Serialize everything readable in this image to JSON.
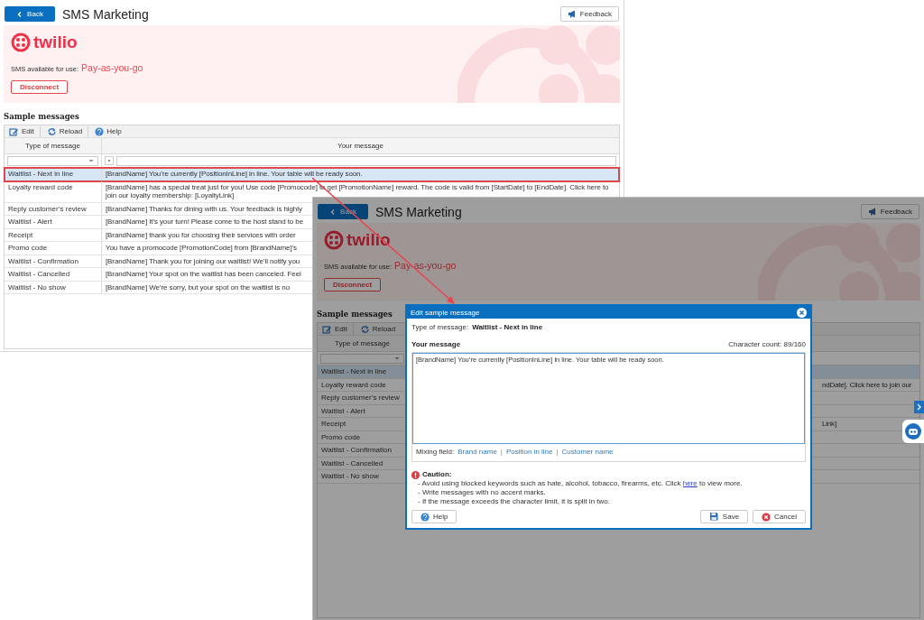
{
  "front_screen": {
    "back_button": "Back",
    "title": "SMS Marketing",
    "feedback_button": "Feedback",
    "banner": {
      "logo": "twilio",
      "sms_label": "SMS available for use:",
      "plan": "Pay-as-you-go",
      "disconnect_button": "Disconnect"
    },
    "section_title": "Sample messages",
    "toolbar": [
      {
        "label": "Edit",
        "kind": "edit"
      },
      {
        "label": "Reload",
        "kind": "reload"
      },
      {
        "label": "Help",
        "kind": "help"
      }
    ],
    "columns": [
      "Type of message",
      "Your message"
    ],
    "rows": [
      {
        "type": "Waitlist - Next in line",
        "message": "[BrandName] You’re currently [PositionInLine] in line. Your table will be ready soon.",
        "selected": true,
        "callout": true
      },
      {
        "type": "Loyalty reward code",
        "message": "[BrandName] has a special treat just for you! Use code [Promocode] to get [PromotionName] reward. The code is valid from [StartDate] to [EndDate]. Click here to join our loyalty membership: [LoyaltyLink]",
        "selected": false,
        "callout": false
      },
      {
        "type": "Reply customer’s review",
        "message": "[BrandName] Thanks for dining with us. Your feedback is highly",
        "selected": false,
        "callout": false
      },
      {
        "type": "Waitlist - Alert",
        "message": "[BrandName] It’s your turn! Please come to the host stand to be",
        "selected": false,
        "callout": false
      },
      {
        "type": "Receipt",
        "message": "[BrandName] thank you for choosing their services with order",
        "selected": false,
        "callout": false
      },
      {
        "type": "Promo code",
        "message": "You have a promocode [PromotionCode] from [BrandName]’s",
        "selected": false,
        "callout": false
      },
      {
        "type": "Waitlist - Confirmation",
        "message": "[BrandName] Thank you for joining our waitlist! We’ll notify you",
        "selected": false,
        "callout": false
      },
      {
        "type": "Waitlist - Cancelled",
        "message": "[BrandName] Your spot on the waitlist has been canceled. Feel",
        "selected": false,
        "callout": false
      },
      {
        "type": "Waitlist - No show",
        "message": "[BrandName] We’re sorry, but your spot on the waitlist is no",
        "selected": false,
        "callout": false
      }
    ]
  },
  "back_screen": {
    "back_button": "Back",
    "title": "SMS Marketing",
    "feedback_button": "Feedback",
    "banner": {
      "logo": "twilio",
      "sms_label": "SMS available for use:",
      "plan": "Pay-as-you-go",
      "disconnect_button": "Disconnect"
    },
    "section_title": "Sample messages",
    "toolbar": [
      {
        "label": "Edit",
        "kind": "edit"
      },
      {
        "label": "Reload",
        "kind": "reload"
      }
    ],
    "columns": [
      "Type of message"
    ],
    "rows": [
      {
        "type": "Waitlist - Next in line",
        "selected": true,
        "callout": false
      },
      {
        "type": "Loyalty reward code",
        "message": "ndDate]. Click here to join our",
        "selected": false,
        "callout": false
      },
      {
        "type": "Reply customer’s review",
        "selected": false,
        "callout": false
      },
      {
        "type": "Waitlist - Alert",
        "selected": false,
        "callout": false
      },
      {
        "type": "Receipt",
        "message": "Link]",
        "selected": false,
        "callout": false
      },
      {
        "type": "Promo code",
        "selected": false,
        "callout": false
      },
      {
        "type": "Waitlist - Confirmation",
        "selected": false,
        "callout": false
      },
      {
        "type": "Waitlist - Cancelled",
        "selected": false,
        "callout": false
      },
      {
        "type": "Waitlist - No show",
        "selected": false,
        "callout": false
      }
    ]
  },
  "dialog": {
    "title": "Edit sample message",
    "type_label": "Type of message:",
    "type_value": "Waitlist - Next in line",
    "message_label": "Your message",
    "char_count": "Character count: 89/160",
    "message": "[BrandName] You’re currently [PositionInLine] in line. Your table will be ready soon.",
    "mixing_label": "Mixing field:",
    "mixing_separator": "|",
    "mixing_fields": [
      "Brand name",
      "Position in line",
      "Customer name"
    ],
    "caution_title": "Caution:",
    "caution_lines": [
      {
        "text": "- Avoid using blocked keywords such as hate, alcohol, tobacco, firearms, etc. Click",
        "link": "here",
        "after": "to view more."
      },
      {
        "text": "- Write messages with no accent marks."
      },
      {
        "text": "- If the message exceeds the character limit, it is split in two."
      }
    ],
    "buttons": [
      {
        "label": "Help",
        "kind": "help"
      },
      {
        "label": "Save",
        "kind": "save"
      },
      {
        "label": "Cancel",
        "kind": "cancel"
      }
    ]
  }
}
